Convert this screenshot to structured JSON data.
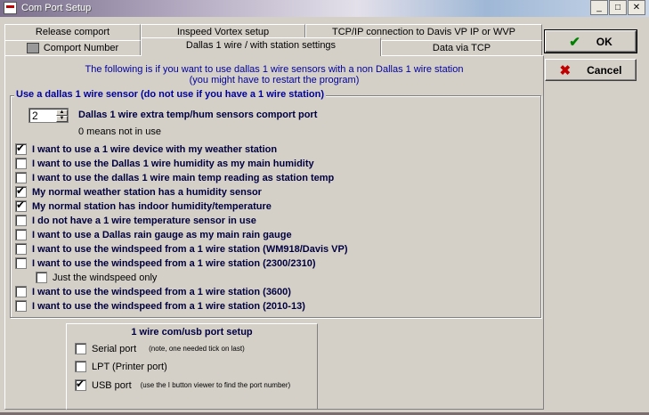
{
  "window": {
    "title": "Com Port Setup"
  },
  "tabs_back": [
    "Release comport",
    "Inspeed Vortex setup",
    "TCP/IP connection to Davis VP IP or WVP"
  ],
  "tabs_front": {
    "comport": "Comport Number",
    "dallas": "Dallas 1 wire / with station settings",
    "tcp": "Data via TCP"
  },
  "info": {
    "line1": "The following is if you want to use dallas 1 wire sensors with a non Dallas 1 wire station",
    "line2": "(you might have to restart the program)"
  },
  "group": {
    "legend": "Use a dallas 1 wire sensor (do not use if you have a 1 wire station)",
    "spin_value": "2",
    "spin_label": "Dallas 1 wire extra temp/hum sensors comport port",
    "spin_note": "0 means not in use",
    "options": [
      {
        "label": "I want to use a 1 wire device with my weather station",
        "checked": true
      },
      {
        "label": "I want to use the Dallas 1 wire humidity as my main humidity",
        "checked": false
      },
      {
        "label": "I want to use the dallas 1 wire main temp reading as station temp",
        "checked": false
      },
      {
        "label": "My normal weather station has a humidity sensor",
        "checked": true
      },
      {
        "label": "My normal station has indoor humidity/temperature",
        "checked": true
      },
      {
        "label": "I do not have a 1 wire temperature sensor in use",
        "checked": false
      },
      {
        "label": "I want to use a Dallas rain gauge as my main rain gauge",
        "checked": false
      },
      {
        "label": "I want to use the windspeed from a 1 wire station (WM918/Davis VP)",
        "checked": false
      },
      {
        "label": "I want to use the windspeed from a 1 wire station (2300/2310)",
        "checked": false
      },
      {
        "label": "Just the windspeed only",
        "checked": false
      },
      {
        "label": "I want to use the windspeed from a 1 wire station (3600)",
        "checked": false
      },
      {
        "label": "I want to use the windspeed from a 1 wire station (2010-13)",
        "checked": false
      }
    ]
  },
  "usb": {
    "title": "1 wire com/usb port setup",
    "serial": {
      "label": "Serial port",
      "note": "(note, one needed tick on last)",
      "checked": false
    },
    "lpt": {
      "label": "LPT (Printer port)",
      "checked": false
    },
    "usb": {
      "label": "USB port",
      "note": "(use the I button viewer to find the port number)",
      "checked": true
    }
  },
  "buttons": {
    "ok": "OK",
    "cancel": "Cancel",
    "ok_icon": "check-icon",
    "cancel_icon": "x-icon"
  },
  "colors": {
    "info_text": "#0000a0",
    "ok_icon": "#008000",
    "cancel_icon": "#c00000"
  }
}
